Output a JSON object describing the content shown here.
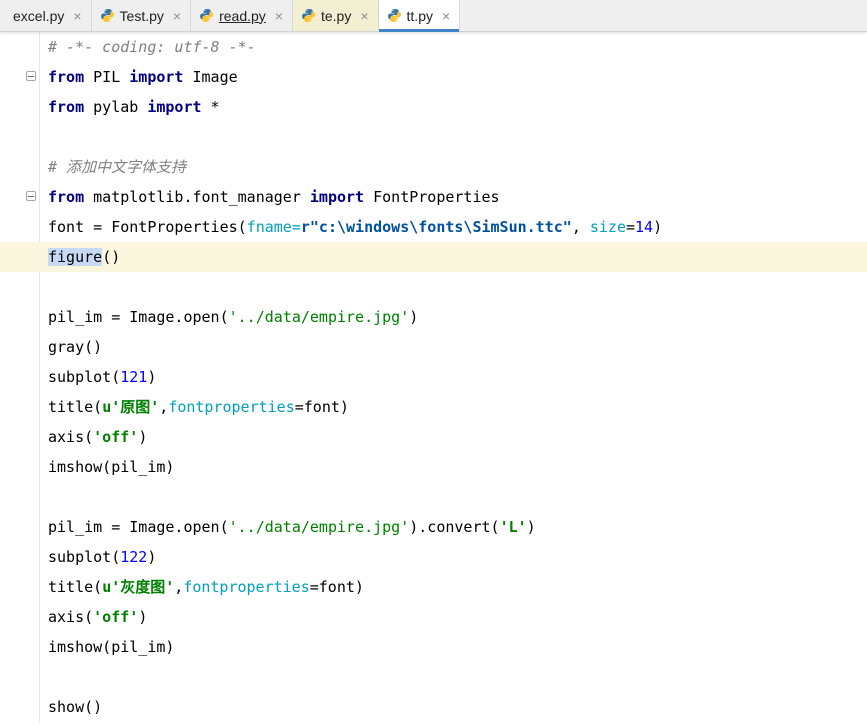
{
  "colors": {
    "keyword": "#000080",
    "comment": "#808080",
    "string": "#008000",
    "number": "#0000ff",
    "kwarg": "#00a0c0",
    "rawstr": "#00509e",
    "currentline": "#fbf7df",
    "wordhl": "#c6d9f5",
    "accent": "#4083c9",
    "tabbar": "#efefef",
    "tabhl": "#f3efd2"
  },
  "tabs": [
    {
      "label": "excel.py",
      "close": "×",
      "state": "plain",
      "icon": false
    },
    {
      "label": "Test.py",
      "close": "×",
      "state": "plain",
      "icon": true
    },
    {
      "label": "read.py",
      "close": "×",
      "state": "underlined",
      "icon": true
    },
    {
      "label": "te.py",
      "close": "×",
      "state": "highlighted",
      "icon": true
    },
    {
      "label": "tt.py",
      "close": "×",
      "state": "active",
      "icon": true
    }
  ],
  "editor": {
    "icon_names": [
      "python-icon",
      "fold-icon",
      "tab-close-icon"
    ],
    "lines": [
      {
        "fold": false,
        "current": false,
        "tokens": [
          {
            "t": "# -*- coding: utf-8 -*-",
            "c": "comment"
          }
        ]
      },
      {
        "fold": true,
        "current": false,
        "tokens": [
          {
            "t": "from",
            "c": "kw"
          },
          {
            "t": " PIL ",
            "c": "plain"
          },
          {
            "t": "import",
            "c": "kw"
          },
          {
            "t": " Image",
            "c": "plain"
          }
        ]
      },
      {
        "fold": false,
        "current": false,
        "tokens": [
          {
            "t": "from",
            "c": "kw"
          },
          {
            "t": " pylab ",
            "c": "plain"
          },
          {
            "t": "import",
            "c": "kw"
          },
          {
            "t": " *",
            "c": "plain"
          }
        ]
      },
      {
        "fold": false,
        "current": false,
        "tokens": []
      },
      {
        "fold": false,
        "current": false,
        "tokens": [
          {
            "t": "# 添加中文字体支持",
            "c": "comment"
          }
        ]
      },
      {
        "fold": true,
        "current": false,
        "tokens": [
          {
            "t": "from",
            "c": "kw"
          },
          {
            "t": " matplotlib.font_manager ",
            "c": "plain"
          },
          {
            "t": "import",
            "c": "kw"
          },
          {
            "t": " FontProperties",
            "c": "plain"
          }
        ]
      },
      {
        "fold": false,
        "current": false,
        "tokens": [
          {
            "t": "font = FontProperties(",
            "c": "plain"
          },
          {
            "t": "fname=",
            "c": "kwarg"
          },
          {
            "t": "r\"c:\\windows\\fonts\\SimSun.ttc\"",
            "c": "rawstr"
          },
          {
            "t": ", ",
            "c": "plain"
          },
          {
            "t": "size",
            "c": "kwarg"
          },
          {
            "t": "=",
            "c": "plain"
          },
          {
            "t": "14",
            "c": "num"
          },
          {
            "t": ")",
            "c": "plain"
          }
        ]
      },
      {
        "fold": false,
        "current": true,
        "tokens": [
          {
            "t": "figure",
            "c": "hl"
          },
          {
            "t": "()",
            "c": "plain"
          }
        ]
      },
      {
        "fold": false,
        "current": false,
        "tokens": []
      },
      {
        "fold": false,
        "current": false,
        "tokens": [
          {
            "t": "pil_im = Image.open(",
            "c": "plain"
          },
          {
            "t": "'../data/empire.jpg'",
            "c": "str"
          },
          {
            "t": ")",
            "c": "plain"
          }
        ]
      },
      {
        "fold": false,
        "current": false,
        "tokens": [
          {
            "t": "gray()",
            "c": "plain"
          }
        ]
      },
      {
        "fold": false,
        "current": false,
        "tokens": [
          {
            "t": "subplot(",
            "c": "plain"
          },
          {
            "t": "121",
            "c": "num"
          },
          {
            "t": ")",
            "c": "plain"
          }
        ]
      },
      {
        "fold": false,
        "current": false,
        "tokens": [
          {
            "t": "title(",
            "c": "plain"
          },
          {
            "t": "u'原图'",
            "c": "strb"
          },
          {
            "t": ",",
            "c": "plain"
          },
          {
            "t": "fontproperties",
            "c": "kwarg"
          },
          {
            "t": "=font)",
            "c": "plain"
          }
        ]
      },
      {
        "fold": false,
        "current": false,
        "tokens": [
          {
            "t": "axis(",
            "c": "plain"
          },
          {
            "t": "'off'",
            "c": "strb"
          },
          {
            "t": ")",
            "c": "plain"
          }
        ]
      },
      {
        "fold": false,
        "current": false,
        "tokens": [
          {
            "t": "imshow(pil_im)",
            "c": "plain"
          }
        ]
      },
      {
        "fold": false,
        "current": false,
        "tokens": []
      },
      {
        "fold": false,
        "current": false,
        "tokens": [
          {
            "t": "pil_im = Image.open(",
            "c": "plain"
          },
          {
            "t": "'../data/empire.jpg'",
            "c": "str"
          },
          {
            "t": ").convert(",
            "c": "plain"
          },
          {
            "t": "'L'",
            "c": "strb"
          },
          {
            "t": ")",
            "c": "plain"
          }
        ]
      },
      {
        "fold": false,
        "current": false,
        "tokens": [
          {
            "t": "subplot(",
            "c": "plain"
          },
          {
            "t": "122",
            "c": "num"
          },
          {
            "t": ")",
            "c": "plain"
          }
        ]
      },
      {
        "fold": false,
        "current": false,
        "tokens": [
          {
            "t": "title(",
            "c": "plain"
          },
          {
            "t": "u'灰度图'",
            "c": "strb"
          },
          {
            "t": ",",
            "c": "plain"
          },
          {
            "t": "fontproperties",
            "c": "kwarg"
          },
          {
            "t": "=font)",
            "c": "plain"
          }
        ]
      },
      {
        "fold": false,
        "current": false,
        "tokens": [
          {
            "t": "axis(",
            "c": "plain"
          },
          {
            "t": "'off'",
            "c": "strb"
          },
          {
            "t": ")",
            "c": "plain"
          }
        ]
      },
      {
        "fold": false,
        "current": false,
        "tokens": [
          {
            "t": "imshow(pil_im)",
            "c": "plain"
          }
        ]
      },
      {
        "fold": false,
        "current": false,
        "tokens": []
      },
      {
        "fold": false,
        "current": false,
        "tokens": [
          {
            "t": "show()",
            "c": "plain"
          }
        ]
      }
    ]
  }
}
